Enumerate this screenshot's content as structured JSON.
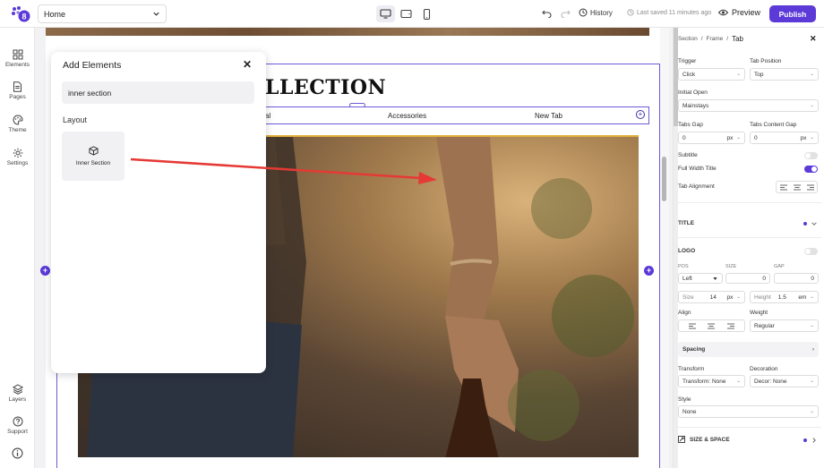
{
  "topbar": {
    "page": "Home",
    "history": "History",
    "saved": "Last saved 11 minutes ago",
    "preview": "Preview",
    "publish": "Publish"
  },
  "leftbar": {
    "elements": "Elements",
    "pages": "Pages",
    "theme": "Theme",
    "settings": "Settings",
    "layers": "Layers",
    "support": "Support"
  },
  "canvas": {
    "title": "LLECTION",
    "tabs": [
      "sonal",
      "Accessories",
      "New Tab"
    ]
  },
  "add_panel": {
    "title": "Add Elements",
    "search_value": "inner section",
    "section": "Layout",
    "item": "Inner Section"
  },
  "rpanel": {
    "crumb": [
      "Section",
      "/",
      "Frame",
      "/",
      "Tab"
    ],
    "trigger_label": "Trigger",
    "trigger_value": "Click",
    "tab_position_label": "Tab Position",
    "tab_position_value": "Top",
    "initial_open_label": "Initial Open",
    "initial_open_value": "Mainstays",
    "tabs_gap_label": "Tabs Gap",
    "tabs_gap_value": "0",
    "tabs_gap_unit": "px",
    "tabs_content_gap_label": "Tabs Content Gap",
    "tabs_content_gap_value": "0",
    "tabs_content_gap_unit": "px",
    "subtitle_label": "Subtitle",
    "full_width_title_label": "Full Width Title",
    "tab_alignment_label": "Tab Alignment",
    "title_section": "TITLE",
    "logo_label": "LOGO",
    "pos_label": "POS",
    "size_label": "SIZE",
    "gap_label": "GAP",
    "pos_value": "Left",
    "size_value": "0",
    "gap_value": "0",
    "font_size_label": "Size",
    "font_size_value": "14",
    "font_size_unit": "px",
    "height_label": "Height",
    "height_value": "1.5",
    "height_unit": "em",
    "align_label": "Align",
    "weight_label": "Weight",
    "weight_value": "Regular",
    "spacing_label": "Spacing",
    "transform_label": "Transform",
    "transform_value": "Transform: None",
    "decoration_label": "Decoration",
    "decoration_value": "Decor: None",
    "style_label": "Style",
    "style_value": "None",
    "size_space_label": "SIZE & SPACE"
  },
  "colors": {
    "accent": "#5b3ad8",
    "selection": "#6b5bd6",
    "arrow": "#e53935"
  },
  "subtitle_on": false,
  "full_width_title_on": true,
  "logo_on": false
}
